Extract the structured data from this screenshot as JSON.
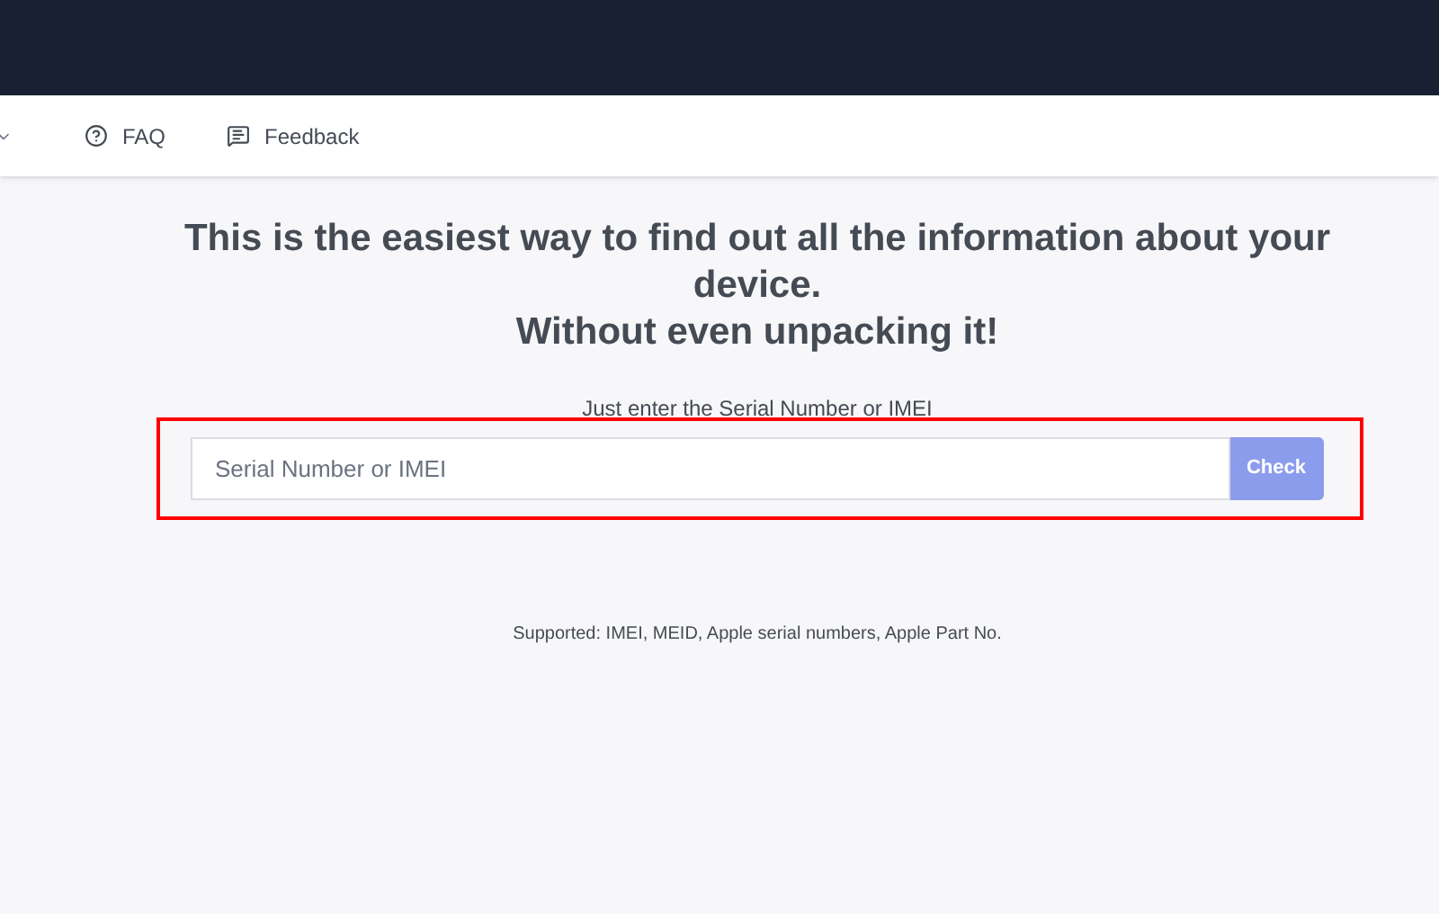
{
  "nav": {
    "items": [
      {
        "kind": "faq",
        "label": "FAQ"
      },
      {
        "kind": "feedback",
        "label": "Feedback"
      }
    ]
  },
  "hero": {
    "title_lines": [
      "This is the easiest way to find out all the information about your device.",
      "Without even unpacking it!"
    ],
    "subtitle": "Just enter the Serial Number or IMEI",
    "search": {
      "placeholder": "Serial Number or IMEI",
      "button": "Check"
    },
    "note": "Supported: IMEI, MEID, Apple serial numbers, Apple Part No."
  }
}
